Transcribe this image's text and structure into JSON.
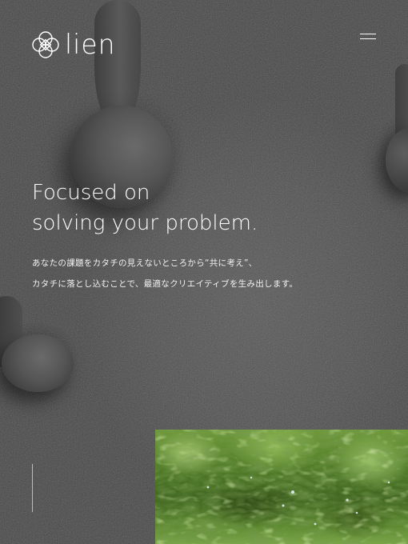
{
  "brand": {
    "logo_text": "lien",
    "logo_icon": "quatrefoil-logo-icon"
  },
  "header": {
    "menu_icon": "hamburger-menu-icon"
  },
  "hero": {
    "headline_line1": "Focused on",
    "headline_line2": "solving your problem.",
    "lead_line1": "あなたの課題をカタチの見えないところから“共に考え”、",
    "lead_line2": "カタチに落とし込むことで、最適なクリエイティブを生み出します。"
  },
  "colors": {
    "background": "#4a4a4a",
    "text": "#ffffff",
    "photo_green": "#5d8a30"
  }
}
